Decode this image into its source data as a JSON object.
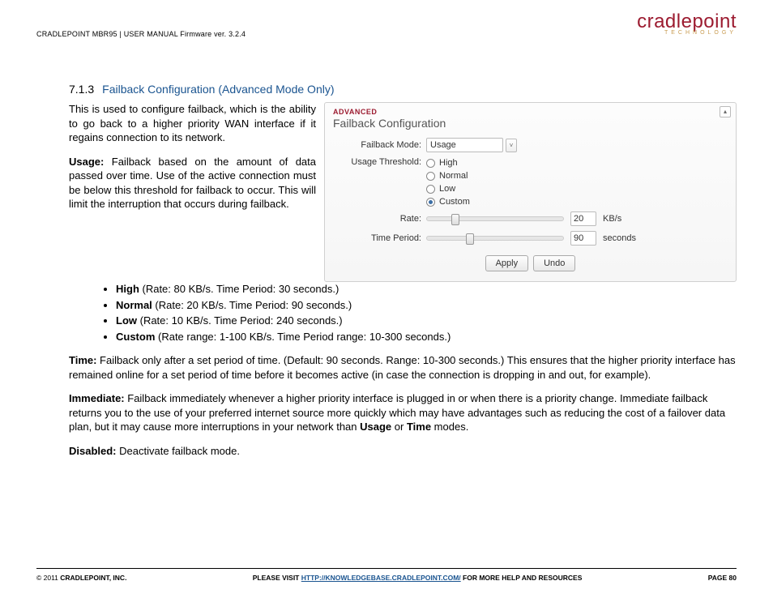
{
  "header": {
    "product_line": "CRADLEPOINT MBR95 | USER MANUAL Firmware ver. 3.2.4",
    "logo_main": "cradlepoint",
    "logo_sub": "TECHNOLOGY"
  },
  "section": {
    "number": "7.1.3",
    "title": "Failback Configuration (Advanced Mode Only)"
  },
  "intro": "This is used to configure failback, which is the ability to go back to a higher priority WAN interface if it regains connection to its network.",
  "usage_para": " Failback based on the amount of data passed over time. Use of the active connection must be below this threshold for failback to occur. This will limit the interruption that occurs during failback.",
  "usage_label": "Usage:",
  "bullets": {
    "high_label": "High",
    "high_desc": " (Rate: 80 KB/s. Time Period: 30 seconds.)",
    "normal_label": "Normal",
    "normal_desc": " (Rate: 20 KB/s. Time Period: 90 seconds.)",
    "low_label": "Low",
    "low_desc": " (Rate: 10 KB/s. Time Period: 240 seconds.)",
    "custom_label": "Custom",
    "custom_desc": " (Rate range: 1-100 KB/s. Time Period range: 10-300 seconds.)"
  },
  "time_label": "Time:",
  "time_para": " Failback only after a set period of time. (Default: 90 seconds. Range: 10-300 seconds.) This ensures that the higher priority interface has remained online for a set period of time before it becomes active (in case the connection is dropping in and out, for example).",
  "immediate_label": "Immediate:",
  "immediate_para_1": " Failback immediately whenever a higher priority interface is plugged in or when there is a priority change. Immediate failback returns you to the use of your preferred internet source more quickly which may have advantages such as reducing the cost of a failover data plan, but it may cause more interruptions in your network than ",
  "immediate_usage": "Usage",
  "immediate_or": " or ",
  "immediate_time": "Time",
  "immediate_para_2": " modes.",
  "disabled_label": "Disabled:",
  "disabled_para": " Deactivate failback mode.",
  "panel": {
    "badge": "ADVANCED",
    "title": "Failback Configuration",
    "mode_label": "Failback Mode:",
    "mode_value": "Usage",
    "threshold_label": "Usage Threshold:",
    "options": {
      "high": "High",
      "normal": "Normal",
      "low": "Low",
      "custom": "Custom"
    },
    "rate_label": "Rate:",
    "rate_value": "20",
    "rate_unit": "KB/s",
    "period_label": "Time Period:",
    "period_value": "90",
    "period_unit": "seconds",
    "apply": "Apply",
    "undo": "Undo"
  },
  "footer": {
    "copyright_year": "© 2011 ",
    "copyright_name": "CRADLEPOINT, INC.",
    "visit_prefix": "PLEASE VISIT ",
    "visit_url": "HTTP://KNOWLEDGEBASE.CRADLEPOINT.COM/",
    "visit_suffix": " FOR MORE HELP AND RESOURCES",
    "page": "PAGE 80"
  }
}
